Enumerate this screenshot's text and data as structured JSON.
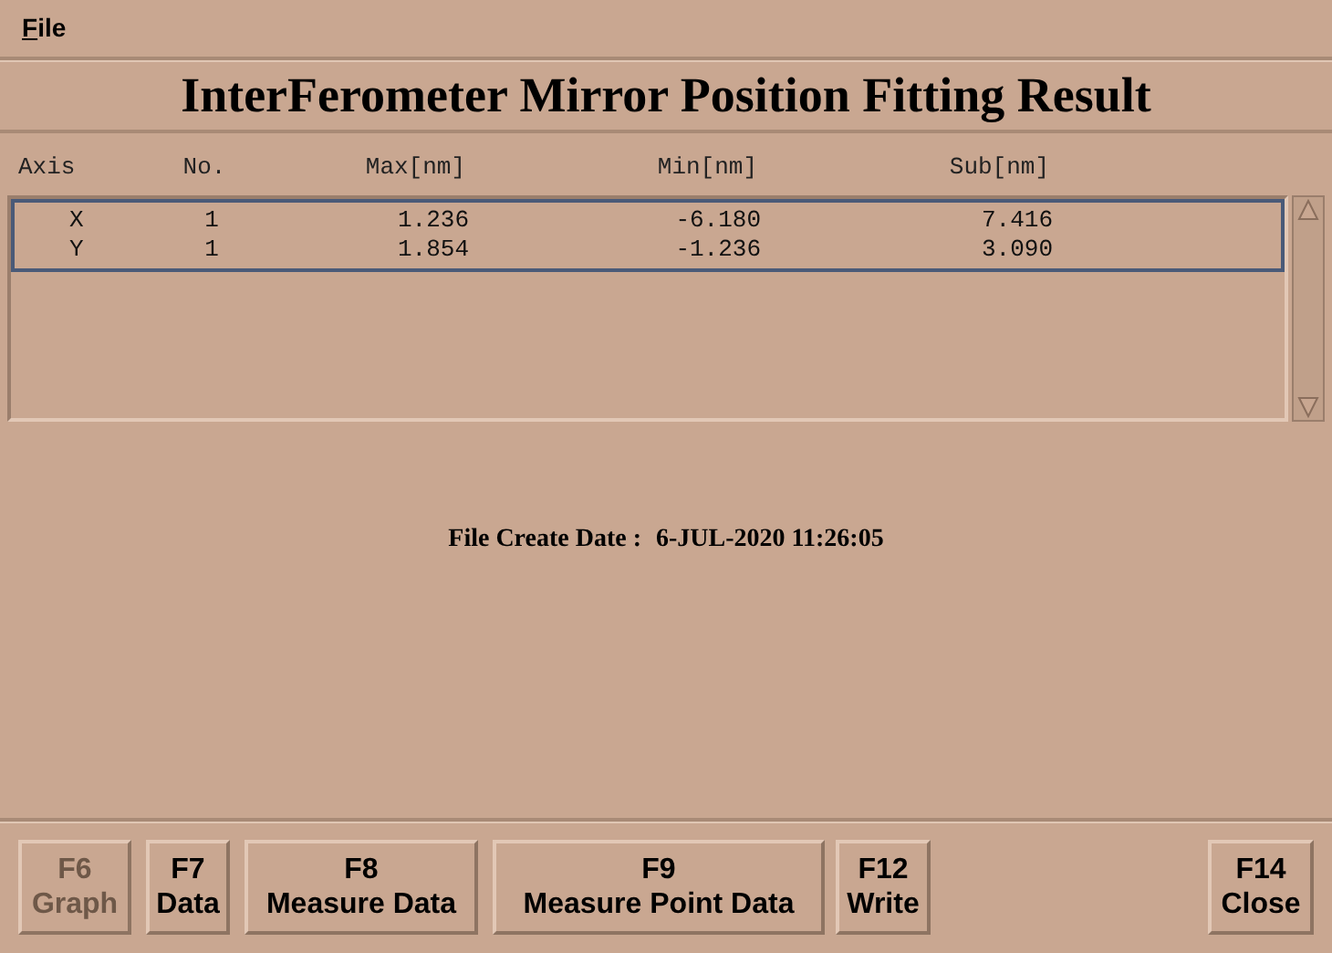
{
  "menu": [
    {
      "label": "File"
    }
  ],
  "title": "InterFerometer Mirror Position Fitting Result",
  "table": {
    "columns": [
      "Axis",
      "No.",
      "Max[nm]",
      "Min[nm]",
      "Sub[nm]"
    ],
    "rows": [
      [
        "X",
        "1",
        "1.236",
        "-6.180",
        "7.416"
      ],
      [
        "Y",
        "1",
        "1.854",
        "-1.236",
        "3.090"
      ]
    ]
  },
  "file_create_date": {
    "label": "File Create Date :",
    "value": "6-JUL-2020 11:26:05"
  },
  "buttons": [
    {
      "key": "F6",
      "label": "Graph",
      "disabled": true
    },
    {
      "key": "F7",
      "label": "Data",
      "disabled": false
    },
    {
      "key": "F8",
      "label": "Measure Data",
      "disabled": false
    },
    {
      "key": "F9",
      "label": "Measure Point Data",
      "disabled": false
    },
    {
      "key": "F12",
      "label": "Write",
      "disabled": false
    },
    {
      "key": "F14",
      "label": "Close",
      "disabled": false
    }
  ]
}
